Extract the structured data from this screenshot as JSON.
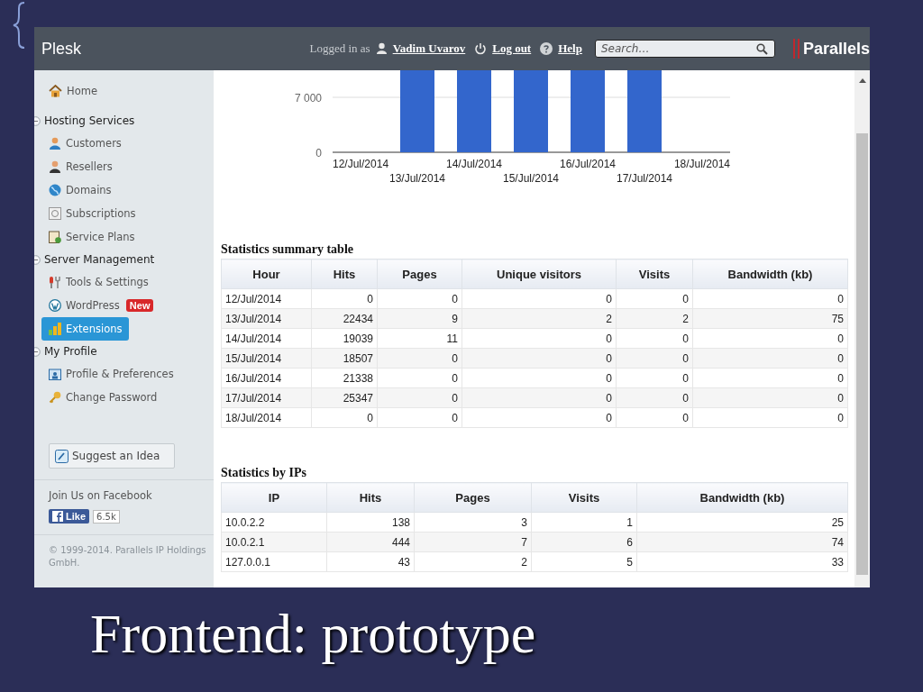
{
  "slide": {
    "title": "Frontend: prototype"
  },
  "header": {
    "title": "Plesk",
    "logged_in_label": "Logged in as",
    "user": "Vadim Uvarov",
    "logout": "Log out",
    "help": "Help",
    "search": {
      "placeholder": "Search…"
    },
    "logo": "Parallels"
  },
  "sidebar": {
    "nav": [
      {
        "kind": "item",
        "label": "Home",
        "selected": false
      },
      {
        "kind": "group",
        "label": "Hosting Services",
        "expanded": true,
        "children": [
          {
            "label": "Customers",
            "selected": false
          },
          {
            "label": "Resellers",
            "selected": false
          },
          {
            "label": "Domains",
            "selected": false
          },
          {
            "label": "Subscriptions",
            "selected": false
          },
          {
            "label": "Service Plans",
            "selected": false
          }
        ]
      },
      {
        "kind": "group",
        "label": "Server Management",
        "expanded": true,
        "children": [
          {
            "label": "Tools & Settings",
            "selected": false
          },
          {
            "label": "WordPress",
            "badge": "New",
            "selected": false
          },
          {
            "label": "Extensions",
            "selected": true
          }
        ]
      },
      {
        "kind": "group",
        "label": "My Profile",
        "expanded": true,
        "children": [
          {
            "label": "Profile & Preferences",
            "selected": false
          },
          {
            "label": "Change Password",
            "selected": false
          }
        ]
      }
    ],
    "suggest_button": "Suggest an Idea",
    "facebook_label": "Join Us on Facebook",
    "like_button": "Like",
    "like_count": "6.5k",
    "copyright": "© 1999-2014. Parallels IP Holdings GmbH."
  },
  "chart": {
    "y_labels": [
      "7 000",
      "0"
    ],
    "x_labels": [
      "12/Jul/2014",
      "13/Jul/2014",
      "14/Jul/2014",
      "15/Jul/2014",
      "16/Jul/2014",
      "17/Jul/2014",
      "18/Jul/2014"
    ]
  },
  "summary_table": {
    "title": "Statistics summary table",
    "columns": [
      "Hour",
      "Hits",
      "Pages",
      "Unique visitors",
      "Visits",
      "Bandwidth (kb)"
    ],
    "rows": [
      [
        "12/Jul/2014",
        "0",
        "0",
        "0",
        "0",
        "0"
      ],
      [
        "13/Jul/2014",
        "22434",
        "9",
        "2",
        "2",
        "75"
      ],
      [
        "14/Jul/2014",
        "19039",
        "11",
        "0",
        "0",
        "0"
      ],
      [
        "15/Jul/2014",
        "18507",
        "0",
        "0",
        "0",
        "0"
      ],
      [
        "16/Jul/2014",
        "21338",
        "0",
        "0",
        "0",
        "0"
      ],
      [
        "17/Jul/2014",
        "25347",
        "0",
        "0",
        "0",
        "0"
      ],
      [
        "18/Jul/2014",
        "0",
        "0",
        "0",
        "0",
        "0"
      ]
    ]
  },
  "ip_table": {
    "title": "Statistics by IPs",
    "columns": [
      "IP",
      "Hits",
      "Pages",
      "Visits",
      "Bandwidth (kb)"
    ],
    "rows": [
      [
        "10.0.2.2",
        "138",
        "3",
        "1",
        "25"
      ],
      [
        "10.0.2.1",
        "444",
        "7",
        "6",
        "74"
      ],
      [
        "127.0.0.1",
        "43",
        "2",
        "5",
        "33"
      ]
    ]
  }
}
